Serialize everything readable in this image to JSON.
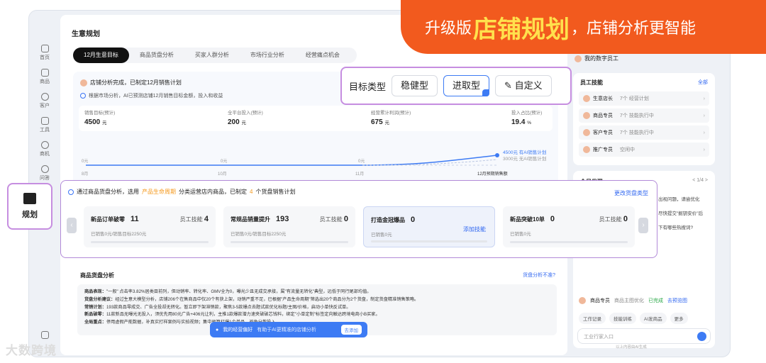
{
  "banner": {
    "prefix": "升级版",
    "highlight": "店铺规划",
    "suffix": "，店铺分析更智能"
  },
  "sidebar": {
    "items": [
      "首页",
      "商品",
      "客户",
      "工具",
      "商机",
      "问答"
    ]
  },
  "plan_tab": {
    "label": "规划"
  },
  "main": {
    "title": "生意规划",
    "tabs": [
      "12月生意目标",
      "商品货盘分析",
      "买家人群分析",
      "市场行业分析",
      "经营痛点机会"
    ],
    "status": "店铺分析完成，已制定12月销售计划",
    "summary": "根据市场分析，AI已预测店铺12月销售目标金额，投入和收益",
    "metrics": [
      {
        "label": "销售目标(预计)",
        "value": "4500",
        "unit": "元"
      },
      {
        "label": "全平台投入(预计)",
        "value": "200",
        "unit": "元"
      },
      {
        "label": "经营累计利润(预计)",
        "value": "675",
        "unit": "元"
      },
      {
        "label": "投入占比(预计)",
        "value": "19.4",
        "unit": "%"
      }
    ],
    "chart": {
      "months": [
        "8月",
        "10月",
        "11月",
        "12月预期销售额"
      ],
      "zero": "0元",
      "ai": "4500元 有AI销售计划",
      "noai": "3000元 无AI销售计划"
    }
  },
  "goal": {
    "label": "目标类型",
    "options": [
      "稳健型",
      "进取型",
      "自定义"
    ],
    "selected": "进取型"
  },
  "plan": {
    "pre": "通过商品货盘分析，选用",
    "hl": "产品生命周期",
    "mid": "分类运营店内商品，已制定",
    "count": "4",
    "post": "个货盘销售计划",
    "change": "更改货盘类型",
    "cards": [
      {
        "title": "新品订单破零",
        "num": "11",
        "skill": "员工技能",
        "skill_num": "4",
        "sub": "已销售0元/销售目标2250元"
      },
      {
        "title": "常规品销量提升",
        "num": "193",
        "skill": "员工技能",
        "skill_num": "0",
        "sub": "已销售0元/销售目标2250元"
      },
      {
        "title": "打造金冠爆品",
        "num": "0",
        "add": "添加技能",
        "sub": "已销售0元"
      },
      {
        "title": "新品突破10单",
        "num": "0",
        "skill": "员工技能",
        "skill_num": "0",
        "sub": "已销售0元"
      }
    ]
  },
  "analysis": {
    "title": "商品货盘分析",
    "link": "货盘分析不准?",
    "rows": [
      {
        "k": "商品表现：",
        "v": "\"一般\" 点击率3.82%居类目前列，但动销率、转化率、GMV全为0，曝光少且无成交承接，属\"有流量无转化\"典型，远低于同行尾部均值。"
      },
      {
        "k": "货盘分析建议：",
        "v": "经过生意大模型分析，店铺206个在售商品中仅20个有获上架，动销严重不足，已根据\"产品生命周期\"筛选出20个商品分为2个货盘，制定货盘精准销售策略。"
      },
      {
        "k": "常销计划：",
        "v": "193款商品零成交、广告全投却无转化。暂立即下架滞销款，聚焦3-5款爆点去题试款优化标题/主图/价格，启动小单快反试单。"
      },
      {
        "k": "新品破零：",
        "v": "11款新品无曝光无投入，须优先用80元广告+406元让利，主推1款爆款潜力速夹破破芯钱料，绑定\"小单定制\"标签定向触达跨境电商小B买家。"
      },
      {
        "k": "全局重点：",
        "v": "停用虚假产能数据，补真实打样案例与实拍视频；集中预算打爆1个单品，避免分散投入。"
      }
    ]
  },
  "pref": {
    "label": "我的经营偏好",
    "hint": "有助于AI更精准的店铺分析",
    "go": "去添加"
  },
  "right": {
    "employee": "我的数字员工",
    "skills_title": "员工技能",
    "skills_all": "全部",
    "skills": [
      {
        "name": "生意店长",
        "count": "7个 经营计划"
      },
      {
        "name": "商品专员",
        "count": "7个 技能执行中"
      },
      {
        "name": "客户专员",
        "count": "7个 技能执行中"
      },
      {
        "name": "推广专员",
        "count": "空闲中"
      }
    ],
    "today": "今日发现",
    "page": "< 1/4 >",
    "lines": [
      "出视问题，请尝优化",
      "尽快提交\"掘钥安价\"后",
      "下有哪些热搜词?"
    ],
    "agent": {
      "name": "商品专员",
      "desc": "商品主图优化",
      "status": "已完成",
      "link": "去预览图"
    },
    "chips": [
      "工作记录",
      "技能训练",
      "AI发商品",
      "更多"
    ],
    "input": "工业行家入口",
    "foot": "以上内容由AI生成"
  },
  "watermark": "大数跨境"
}
